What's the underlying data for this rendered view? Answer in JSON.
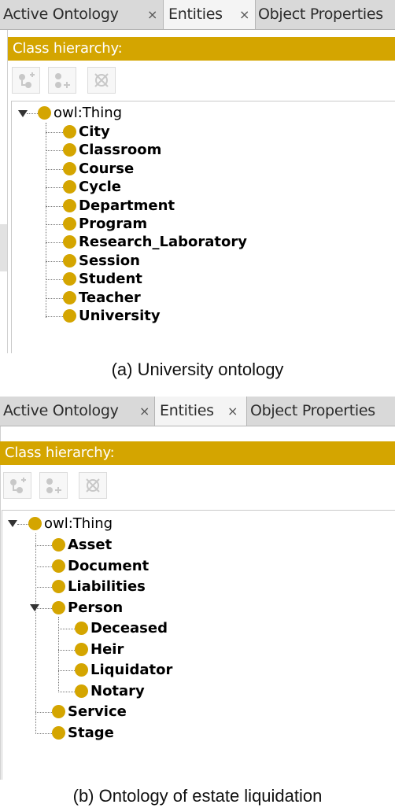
{
  "panel_a": {
    "tabs": [
      {
        "label": "Active Ontology",
        "close": "×"
      },
      {
        "label": "Entities",
        "close": "×"
      },
      {
        "label": "Object Properties"
      }
    ],
    "header": "Class hierarchy:",
    "root": "owl:Thing",
    "classes": [
      "City",
      "Classroom",
      "Course",
      "Cycle",
      "Department",
      "Program",
      "Research_Laboratory",
      "Session",
      "Student",
      "Teacher",
      "University"
    ]
  },
  "caption_a": "(a) University ontology",
  "panel_b": {
    "tabs": [
      {
        "label": "Active Ontology",
        "close": "×"
      },
      {
        "label": "Entities",
        "close": "×"
      },
      {
        "label": "Object Properties"
      }
    ],
    "header": "Class hierarchy:",
    "root": "owl:Thing",
    "classes": [
      "Asset",
      "Document",
      "Liabilities",
      "Person",
      "Service",
      "Stage"
    ],
    "person_subclasses": [
      "Deceased",
      "Heir",
      "Liquidator",
      "Notary"
    ]
  },
  "caption_b": "(b) Ontology of estate liquidation",
  "toolbar_icons": [
    "add-subclass-icon",
    "add-sibling-class-icon",
    "delete-class-icon"
  ],
  "colors": {
    "header": "#d4a500",
    "class_dot": "#d4a500",
    "tab_bar": "#d9d9d9"
  }
}
